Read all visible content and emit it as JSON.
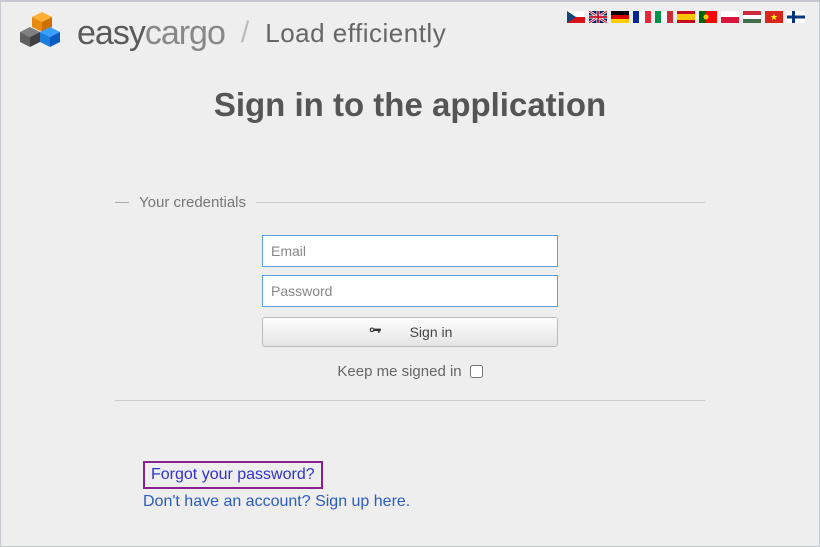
{
  "brand": {
    "easy": "easy",
    "cargo": "cargo",
    "slash": "/",
    "tagline": "Load efficiently"
  },
  "flags": [
    {
      "name": "czech-flag"
    },
    {
      "name": "uk-flag"
    },
    {
      "name": "germany-flag"
    },
    {
      "name": "france-flag"
    },
    {
      "name": "italy-flag"
    },
    {
      "name": "spain-flag"
    },
    {
      "name": "portugal-flag"
    },
    {
      "name": "poland-flag"
    },
    {
      "name": "hungary-flag"
    },
    {
      "name": "vietnam-flag"
    },
    {
      "name": "finland-flag"
    }
  ],
  "heading": "Sign in to the application",
  "legend": "Your credentials",
  "form": {
    "email_placeholder": "Email",
    "password_placeholder": "Password",
    "signin_label": "Sign in",
    "keep_label": "Keep me signed in"
  },
  "links": {
    "forgot": "Forgot your password?",
    "signup_text": "Don't have an account? ",
    "signup_link": "Sign up here."
  }
}
